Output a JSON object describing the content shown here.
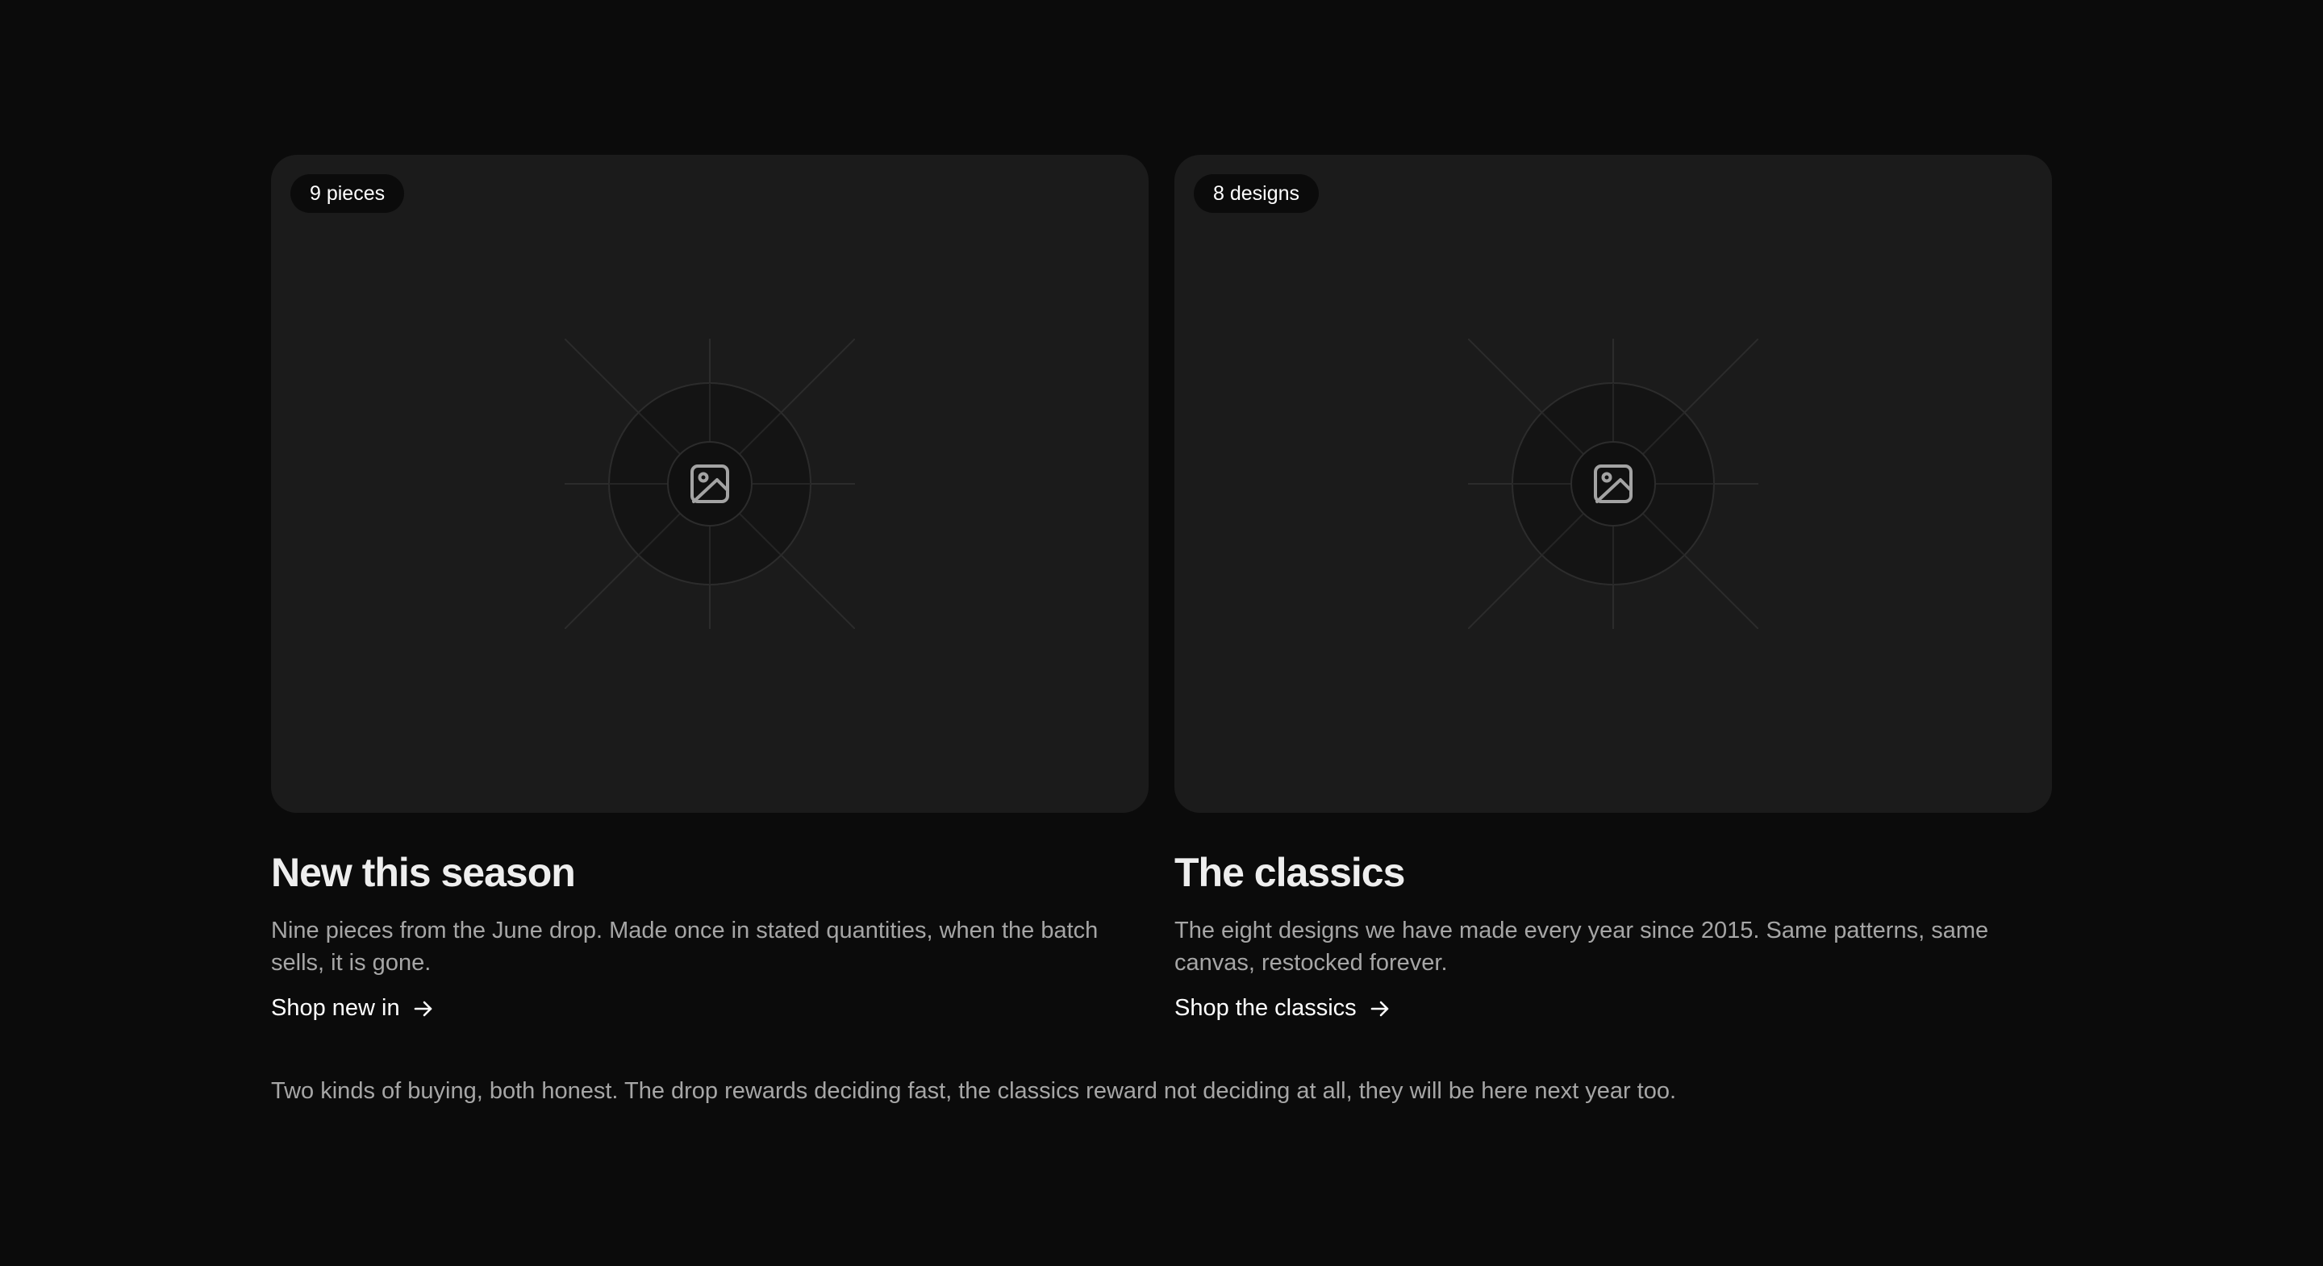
{
  "cards": [
    {
      "badge": "9 pieces",
      "title": "New this season",
      "description": "Nine pieces from the June drop. Made once in stated quantities, when the batch sells, it is gone.",
      "link_label": "Shop new in",
      "image_icon": "image-icon",
      "link_icon": "arrow-right-icon"
    },
    {
      "badge": "8 designs",
      "title": "The classics",
      "description": "The eight designs we have made every year since 2015. Same patterns, same canvas, restocked forever.",
      "link_label": "Shop the classics",
      "image_icon": "image-icon",
      "link_icon": "arrow-right-icon"
    }
  ],
  "footnote": "Two kinds of buying, both honest. The drop rewards deciding fast, the classics reward not deciding at all, they will be here next year too.",
  "colors": {
    "page_background": "#0b0b0b",
    "card_background": "#1b1b1b",
    "badge_background": "#0b0b0b",
    "heading": "#eeeeee",
    "body_text": "#a6a6a6",
    "link": "#ffffff"
  }
}
